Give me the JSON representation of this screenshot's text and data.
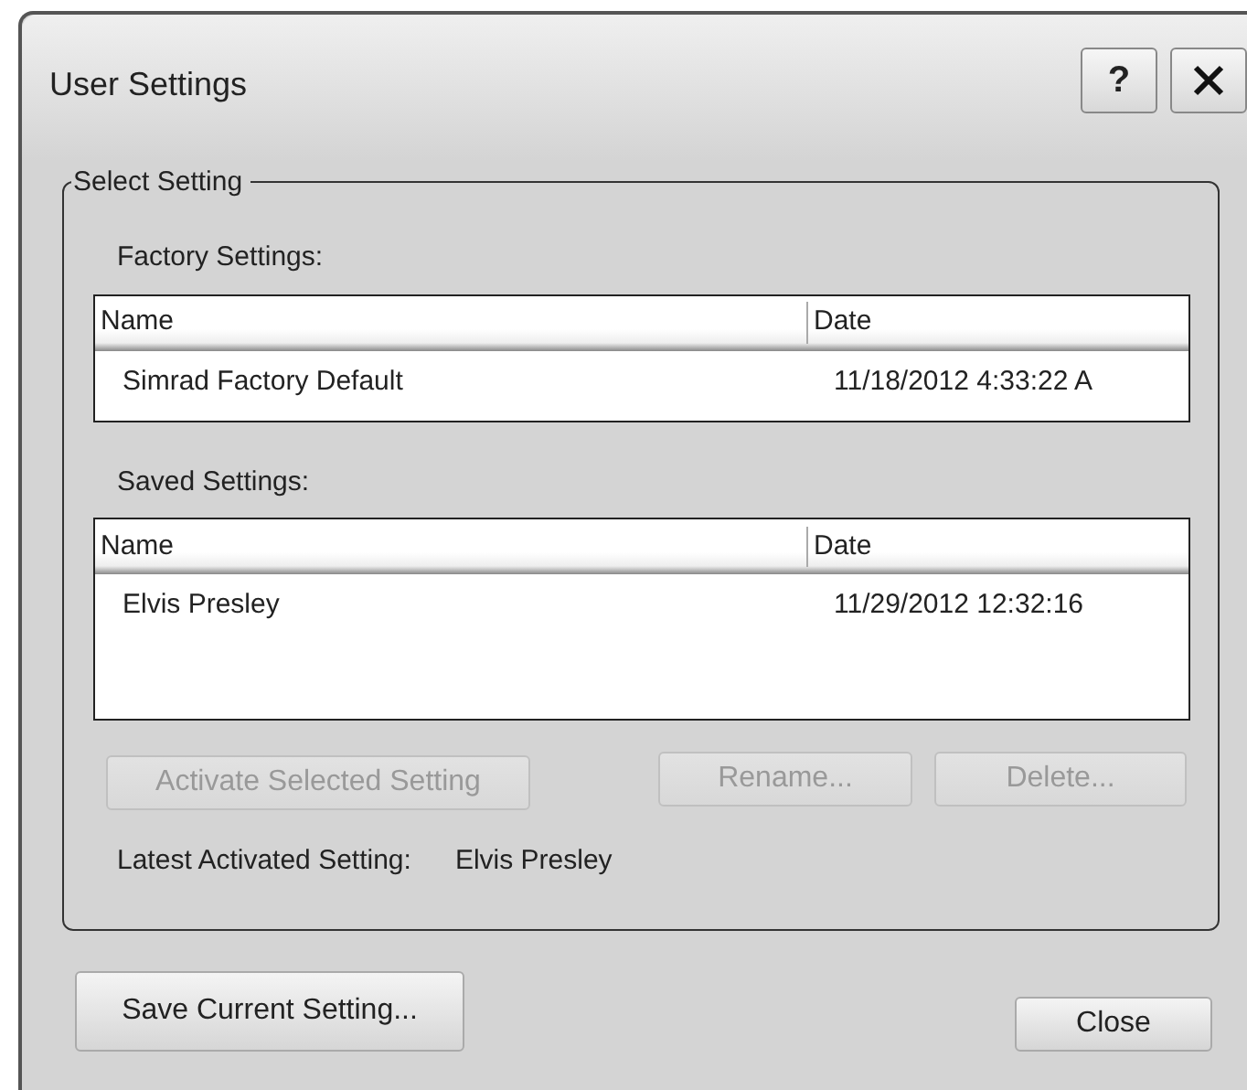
{
  "window": {
    "title": "User Settings",
    "help_label": "?"
  },
  "select_setting": {
    "legend": "Select Setting",
    "lists": [
      {
        "label": "Factory Settings:",
        "columns": [
          "Name",
          "Date"
        ],
        "rows": [
          {
            "name": "Simrad Factory Default",
            "date": "11/18/2012 4:33:22 A",
            "selected": false
          }
        ],
        "kind": "short"
      },
      {
        "label": "Saved Settings:",
        "columns": [
          "Name",
          "Date"
        ],
        "rows": [
          {
            "name": "Elvis Presley",
            "date": "11/29/2012 12:32:16",
            "selected": false
          }
        ],
        "kind": "tall"
      }
    ],
    "actions": [
      {
        "label": "Activate Selected Setting",
        "disabled": true
      },
      {
        "label": "Rename...",
        "disabled": true
      },
      {
        "label": "Delete...",
        "disabled": true
      }
    ],
    "latest": {
      "label": "Latest Activated Setting:",
      "value": "Elvis Presley"
    }
  },
  "footer": [
    {
      "label": "Save Current Setting...",
      "disabled": false
    },
    {
      "label": "Close",
      "disabled": false
    }
  ]
}
